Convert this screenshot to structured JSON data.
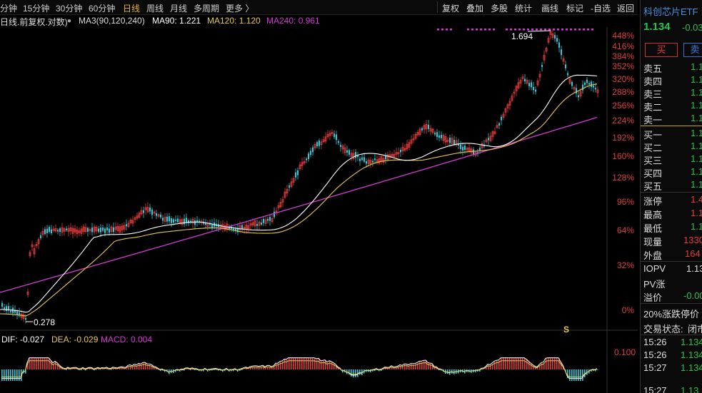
{
  "toolbar": {
    "periods": [
      "分钟",
      "15分钟",
      "30分钟",
      "60分钟",
      "日线",
      "周线",
      "月线",
      "多周期",
      "更多 〉"
    ],
    "active_period": "日线",
    "right_buttons": [
      "复权",
      "叠加",
      "多股",
      "统计",
      "画线",
      "标记",
      "-自选",
      "返回"
    ]
  },
  "legend": {
    "label": "日线.前复权.对数)",
    "ma_title": "MA3(90,120,240)",
    "ma90": "MA90: 1.221",
    "ma120": "MA120: 1.120",
    "ma240": "MA240: 0.961",
    "colors": {
      "ma90": "#ffffff",
      "ma120": "#e8c84a",
      "ma240": "#d63ad6",
      "up": "#e03c3c",
      "down": "#31c9d9"
    }
  },
  "price_axis": [
    "448%",
    "416%",
    "384%",
    "352%",
    "320%",
    "288%",
    "256%",
    "224%",
    "192%",
    "160%",
    "128%",
    "96%",
    "64%",
    "32%",
    "0%"
  ],
  "annotations": {
    "high": "1.694",
    "low": "0.278",
    "marker": "S"
  },
  "macd": {
    "dif": "DIF: -0.027",
    "dea": "DEA: -0.029",
    "macd": "MACD: 0.004",
    "axis": "0.100"
  },
  "right_panel": {
    "title": "科创芯片ETF",
    "price": "1.134",
    "change": "-0.03",
    "buy_button": "买",
    "sell_button": "卖",
    "ask_labels": [
      "卖五",
      "卖四",
      "卖三",
      "卖二",
      "卖一"
    ],
    "bid_labels": [
      "买一",
      "买二",
      "买三",
      "买四",
      "买五"
    ],
    "book_values": [
      "1.1",
      "1.1",
      "1.1",
      "1.1",
      "1.1",
      "1.1",
      "1.1",
      "1.1",
      "1.1",
      "1.1"
    ],
    "stats": [
      {
        "label": "涨停",
        "value": "1.4",
        "color": "#e03c3c"
      },
      {
        "label": "最高",
        "value": "1.1",
        "color": "#e03c3c"
      },
      {
        "label": "最低",
        "value": "1.1",
        "color": "#25c24f"
      },
      {
        "label": "现量",
        "value": "1330",
        "color": "#e03c3c"
      },
      {
        "label": "外盘",
        "value": "164",
        "color": "#e03c3c"
      }
    ],
    "iopv": [
      {
        "label": "IOPV",
        "value": "1.13",
        "color": "#dddddd"
      },
      {
        "label": "PV涨",
        "value": "",
        "color": "#dddddd"
      },
      {
        "label": "溢价",
        "value": "-0.00",
        "color": "#25c24f"
      }
    ],
    "limit_text": "20%涨跌停价",
    "status_label": "交易状态:",
    "status_value": "闭市",
    "ticks": [
      {
        "time": "15:26",
        "price": "1.134"
      },
      {
        "time": "15:26",
        "price": "1.134"
      },
      {
        "time": "15:27",
        "price": "1.134"
      },
      {
        "time": "15:27",
        "price": "1.13"
      }
    ]
  }
}
